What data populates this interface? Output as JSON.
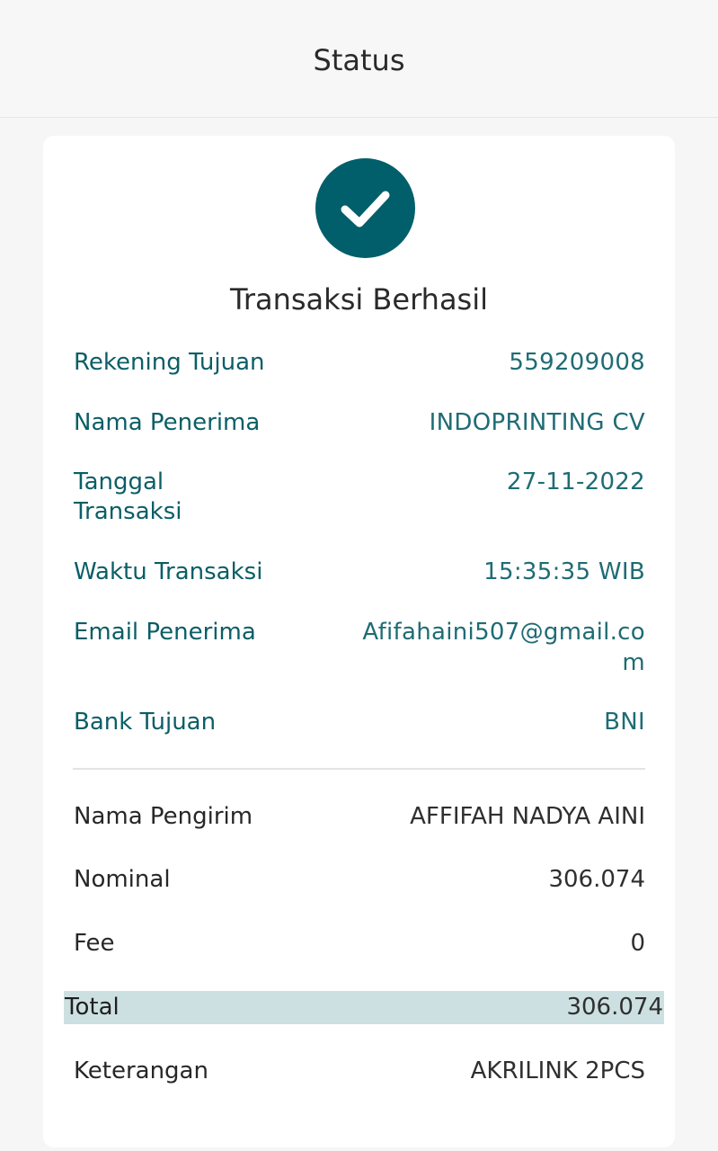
{
  "header": {
    "title": "Status"
  },
  "status": {
    "title": "Transaksi Berhasil",
    "icon": "check-icon",
    "color": "#005f6a"
  },
  "recipient": {
    "rekening_label": "Rekening Tujuan",
    "rekening_value": "559209008",
    "nama_label": "Nama Penerima",
    "nama_value": "INDOPRINTING CV",
    "tanggal_label_line1": "Tanggal",
    "tanggal_label_line2": "Transaksi",
    "tanggal_value": "27-11-2022",
    "waktu_label": "Waktu Transaksi",
    "waktu_value": "15:35:35 WIB",
    "email_label": "Email Penerima",
    "email_value_line1": "Afifahaini507@gmail.co",
    "email_value_line2": "m",
    "bank_label": "Bank Tujuan",
    "bank_value": "BNI"
  },
  "sender": {
    "nama_label": "Nama Pengirim",
    "nama_value": "AFFIFAH NADYA AINI",
    "nominal_label": "Nominal",
    "nominal_value": "306.074",
    "fee_label": "Fee",
    "fee_value": "0",
    "total_label": "Total",
    "total_value": "306.074",
    "keterangan_label": "Keterangan",
    "keterangan_value": "AKRILINK 2PCS"
  },
  "colors": {
    "accent": "#005f6a",
    "teal_text": "#0b5e66",
    "total_highlight": "#cde0e1"
  }
}
